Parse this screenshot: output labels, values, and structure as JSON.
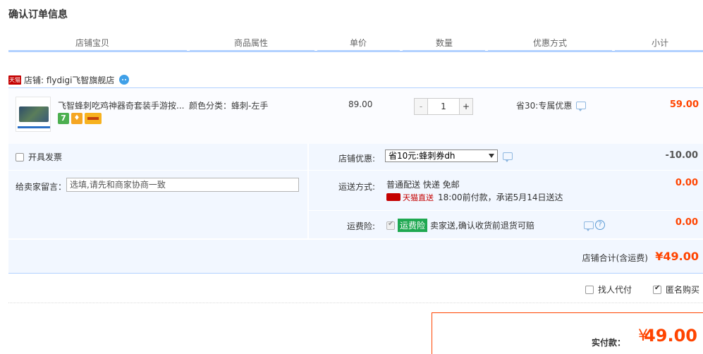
{
  "page_title": "确认订单信息",
  "columns": [
    "店铺宝贝",
    "商品属性",
    "单价",
    "数量",
    "优惠方式",
    "小计"
  ],
  "shop": {
    "badge": "天猫",
    "label": "店铺: flydigi飞智旗舰店"
  },
  "item": {
    "title": "飞智蜂刺吃鸡神器奇套装手游按...",
    "attr": "颜色分类：蜂刺-左手",
    "price": "89.00",
    "quantity": "1",
    "qty_minus": "-",
    "qty_plus": "+",
    "discount": "省30:专属优惠",
    "subtotal": "59.00",
    "icons": [
      "seven-day-return-icon",
      "shield-icon",
      "credit-card-icon"
    ]
  },
  "invoice_label": "开具发票",
  "memo": {
    "label": "给卖家留言：",
    "placeholder": "选填,请先和商家协商一致"
  },
  "shop_coupon": {
    "label": "店铺优惠:",
    "selected": "省10元:蜂刺券dh",
    "amount": "-10.00"
  },
  "shipping": {
    "label": "运送方式:",
    "method": "普通配送 快递 免邮",
    "tmall_direct": "天猫直送",
    "promise": "18:00前付款，承诺5月14日送达",
    "amount": "0.00"
  },
  "insurance": {
    "label": "运费险:",
    "badge": "运费险",
    "text": "卖家送,确认收货前退货可赔",
    "amount": "0.00"
  },
  "shop_total": {
    "label": "店铺合计(含运费)",
    "value": "¥49.00"
  },
  "options": {
    "proxy_pay": "找人代付",
    "anonymous": "匿名购买"
  },
  "payment": {
    "label": "实付款：",
    "symbol": "¥",
    "value": "49.00"
  },
  "colors": {
    "accent_red": "#ff4400",
    "header_border": "#b2d1ff",
    "panel_bg": "#f2f7ff"
  }
}
